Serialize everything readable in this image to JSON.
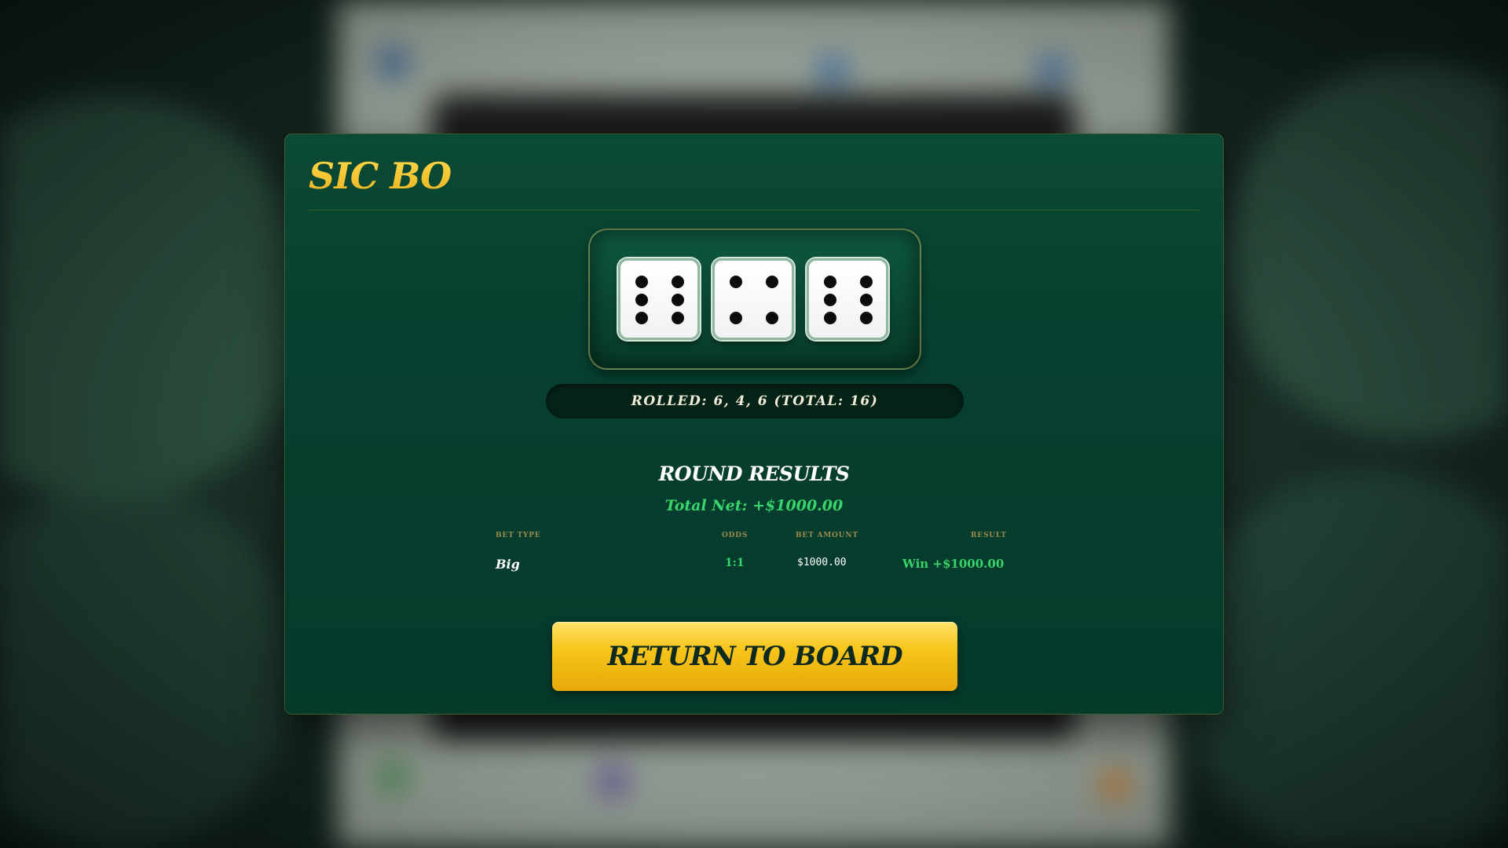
{
  "game": {
    "title": "SIC BO"
  },
  "dice": [
    {
      "value": 6,
      "icon": "die-six-icon"
    },
    {
      "value": 4,
      "icon": "die-four-icon"
    },
    {
      "value": 6,
      "icon": "die-six-icon"
    }
  ],
  "roll": {
    "summary": "ROLLED: 6, 4, 6 (TOTAL: 16)"
  },
  "results": {
    "title": "ROUND RESULTS",
    "total_net": "Total Net: +$1000.00",
    "headers": {
      "bet_type": "BET TYPE",
      "odds": "ODDS",
      "bet_amount": "BET AMOUNT",
      "result": "RESULT"
    },
    "rows": [
      {
        "bet_type": "Big",
        "odds": "1:1",
        "bet_amount": "$1000.00",
        "result": "Win +$1000.00"
      }
    ]
  },
  "actions": {
    "return_label": "RETURN TO BOARD"
  },
  "colors": {
    "gold": "#f2c230",
    "felt": "#064030",
    "win_green": "#39d46a"
  }
}
